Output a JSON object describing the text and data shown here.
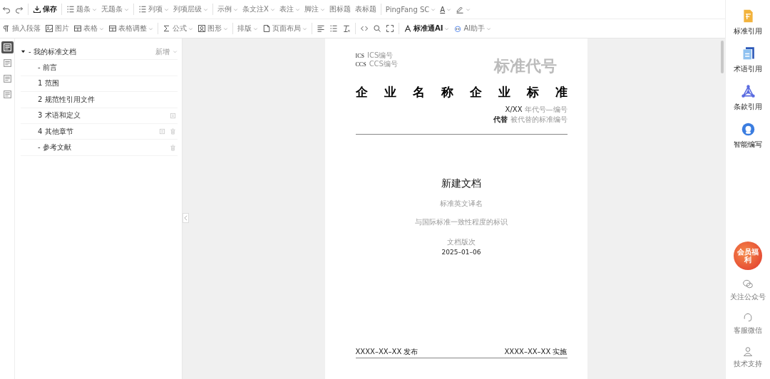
{
  "toolbar_top": {
    "items": [
      {
        "kind": "tool"
      },
      {
        "kind": "tool"
      },
      {
        "kind": "sep"
      },
      {
        "kind": "tool",
        "label": "保存",
        "caret": false
      },
      {
        "kind": "sep"
      },
      {
        "kind": "tool",
        "label": "题条",
        "caret": true
      },
      {
        "kind": "tool",
        "label": "无题条",
        "caret": true
      },
      {
        "kind": "sep"
      },
      {
        "kind": "tool",
        "label": "列项",
        "caret": true
      },
      {
        "kind": "tool",
        "label": "列项层级",
        "caret": true
      },
      {
        "kind": "sep"
      },
      {
        "kind": "tool",
        "label": "示例",
        "caret": true
      },
      {
        "kind": "tool",
        "label": "条文注X",
        "caret": true
      },
      {
        "kind": "tool",
        "label": "表注",
        "caret": true
      },
      {
        "kind": "tool",
        "label": "脚注",
        "caret": true
      },
      {
        "kind": "tool",
        "label": "图标题",
        "caret": false
      },
      {
        "kind": "tool",
        "label": "表标题",
        "caret": false
      },
      {
        "kind": "sep"
      },
      {
        "kind": "tool",
        "label": "PingFang SC",
        "caret": true
      },
      {
        "kind": "tool",
        "label": "A",
        "caret": true
      },
      {
        "kind": "tool",
        "caret": true
      }
    ]
  },
  "toolbar_bottom": {
    "items": [
      {
        "kind": "tool",
        "label": "插入段落",
        "caret": false
      },
      {
        "kind": "tool",
        "label": "图片",
        "caret": false
      },
      {
        "kind": "tool",
        "label": "表格",
        "caret": true
      },
      {
        "kind": "tool",
        "label": "表格调整",
        "caret": true
      },
      {
        "kind": "sep"
      },
      {
        "kind": "tool",
        "label": "公式",
        "caret": true
      },
      {
        "kind": "tool",
        "label": "图形",
        "caret": true
      },
      {
        "kind": "sep"
      },
      {
        "kind": "tool",
        "label": "排版",
        "caret": true
      },
      {
        "kind": "tool",
        "label": "页面布局",
        "caret": true
      },
      {
        "kind": "sep"
      },
      {
        "kind": "tool"
      },
      {
        "kind": "tool"
      },
      {
        "kind": "tool"
      },
      {
        "kind": "sep"
      },
      {
        "kind": "tool"
      },
      {
        "kind": "tool"
      },
      {
        "kind": "tool"
      },
      {
        "kind": "sep"
      },
      {
        "kind": "tool",
        "label": "标准通AI",
        "caret": true
      },
      {
        "kind": "tool",
        "label": "AI助手",
        "caret": true
      }
    ]
  },
  "rail": [
    {
      "selected": true
    },
    {
      "selected": false
    },
    {
      "selected": false
    },
    {
      "selected": false
    }
  ],
  "tree": {
    "label": "- 我的标准文档",
    "expanded": true,
    "action": "新增",
    "children": [
      {
        "label": "- 前言",
        "copy": false,
        "delete": false
      },
      {
        "label": "1 范围",
        "copy": false,
        "delete": false
      },
      {
        "label": "2 规范性引用文件",
        "copy": false,
        "delete": false
      },
      {
        "label": "3 术语和定义",
        "copy": true,
        "delete": false
      },
      {
        "label": "4 其他章节",
        "copy": true,
        "delete": true
      },
      {
        "label": "- 参考文献",
        "copy": false,
        "delete": true
      }
    ]
  },
  "page": {
    "ics_label": "ICS",
    "ics_hint": "ICS编号",
    "ccs_label": "CCS",
    "ccs_hint": "CCS编号",
    "code_hint": "标准代号",
    "title": "企业名称企业标准",
    "number": "X/XX",
    "number_hint": "年代号—编号",
    "replace_label": "代替",
    "replace_hint": "被代替的标准编号",
    "doc_title": "新建文档",
    "english_hint": "标准英文译名",
    "consistency_hint": "与国际标准一致性程度的标识",
    "version_hint": "文档版次",
    "date": "2025–01–06",
    "publish": "XXXX–XX–XX 发布",
    "implement": "XXXX–XX–XX 实施"
  },
  "sidebar": {
    "tools": [
      {
        "label": "标准引用"
      },
      {
        "label": "术语引用"
      },
      {
        "label": "条款引用"
      },
      {
        "label": "智能编写"
      }
    ],
    "promo": "会员福利",
    "links": [
      {
        "label": "关注公众号"
      },
      {
        "label": "客服微信"
      },
      {
        "label": "技术支持"
      }
    ]
  }
}
